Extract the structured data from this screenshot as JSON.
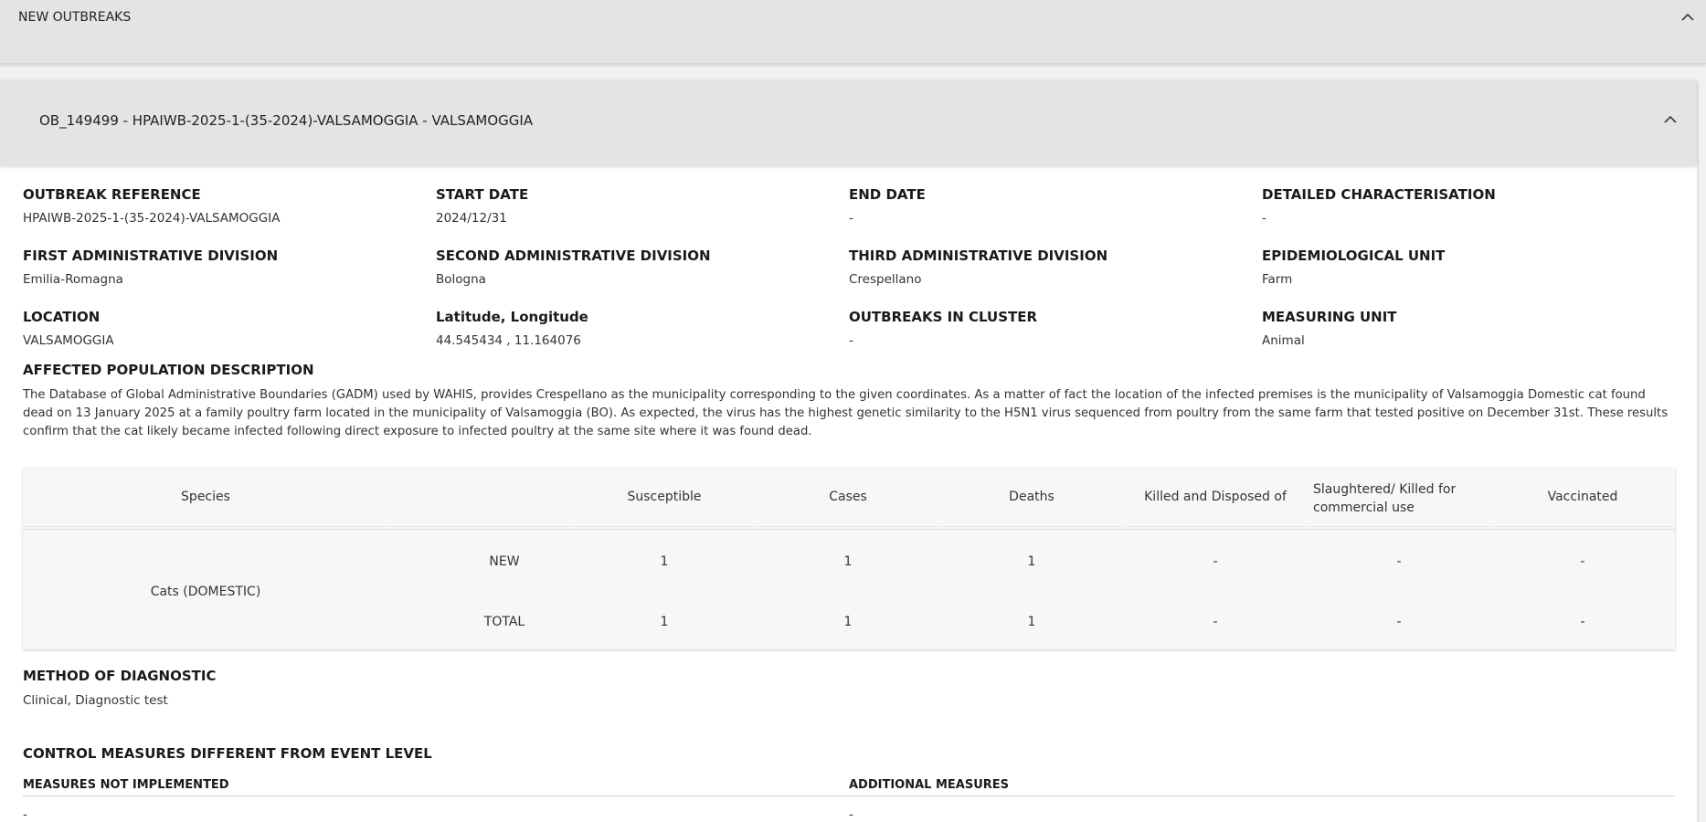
{
  "new_outbreaks": {
    "title": "NEW OUTBREAKS"
  },
  "outbreak": {
    "title": "OB_149499 - HPAIWB-2025-1-(35-2024)-VALSAMOGGIA - VALSAMOGGIA",
    "fields": {
      "outbreak_reference": {
        "label": "OUTBREAK REFERENCE",
        "value": "HPAIWB-2025-1-(35-2024)-VALSAMOGGIA"
      },
      "start_date": {
        "label": "START DATE",
        "value": "2024/12/31"
      },
      "end_date": {
        "label": "END DATE",
        "value": "-"
      },
      "detailed_characterisation": {
        "label": "DETAILED CHARACTERISATION",
        "value": "-"
      },
      "first_admin": {
        "label": "FIRST ADMINISTRATIVE DIVISION",
        "value": "Emilia-Romagna"
      },
      "second_admin": {
        "label": "SECOND ADMINISTRATIVE DIVISION",
        "value": "Bologna"
      },
      "third_admin": {
        "label": "THIRD ADMINISTRATIVE DIVISION",
        "value": "Crespellano"
      },
      "epi_unit": {
        "label": "EPIDEMIOLOGICAL UNIT",
        "value": "Farm"
      },
      "location": {
        "label": "LOCATION",
        "value": "VALSAMOGGIA"
      },
      "lat_lon": {
        "label": "Latitude, Longitude",
        "value": "44.545434 , 11.164076"
      },
      "outbreaks_in_cluster": {
        "label": "OUTBREAKS IN CLUSTER",
        "value": "-"
      },
      "measuring_unit": {
        "label": "MEASURING UNIT",
        "value": "Animal"
      }
    },
    "affected_population": {
      "label": "AFFECTED POPULATION DESCRIPTION",
      "text": "The Database of Global Administrative Boundaries (GADM) used by WAHIS, provides Crespellano as the municipality corresponding to the given coordinates. As a matter of fact the location of the infected premises is the municipality of Valsamoggia Domestic cat found dead on 13 January 2025 at a family poultry farm located in the municipality of Valsamoggia (BO). As expected, the virus has the highest genetic similarity to the H5N1 virus sequenced from poultry from the same farm that tested positive on December 31st. These results confirm that the cat likely became infected following direct exposure to infected poultry at the same site where it was found dead."
    },
    "table": {
      "headers": {
        "species": "Species",
        "susceptible": "Susceptible",
        "cases": "Cases",
        "deaths": "Deaths",
        "killed": "Killed and Disposed of",
        "slaughtered": "Slaughtered/ Killed for commercial use",
        "vaccinated": "Vaccinated"
      },
      "species": "Cats (DOMESTIC)",
      "rows": [
        {
          "type": "NEW",
          "susceptible": "1",
          "cases": "1",
          "deaths": "1",
          "killed": "-",
          "slaughtered": "-",
          "vaccinated": "-"
        },
        {
          "type": "TOTAL",
          "susceptible": "1",
          "cases": "1",
          "deaths": "1",
          "killed": "-",
          "slaughtered": "-",
          "vaccinated": "-"
        }
      ]
    },
    "diagnostic": {
      "label": "METHOD OF DIAGNOSTIC",
      "value": "Clinical, Diagnostic test"
    },
    "control_measures": {
      "label": "CONTROL MEASURES DIFFERENT FROM EVENT LEVEL",
      "not_implemented_label": "MEASURES NOT IMPLEMENTED",
      "not_implemented_value": "-",
      "additional_label": "ADDITIONAL MEASURES",
      "additional_value": "-"
    }
  }
}
